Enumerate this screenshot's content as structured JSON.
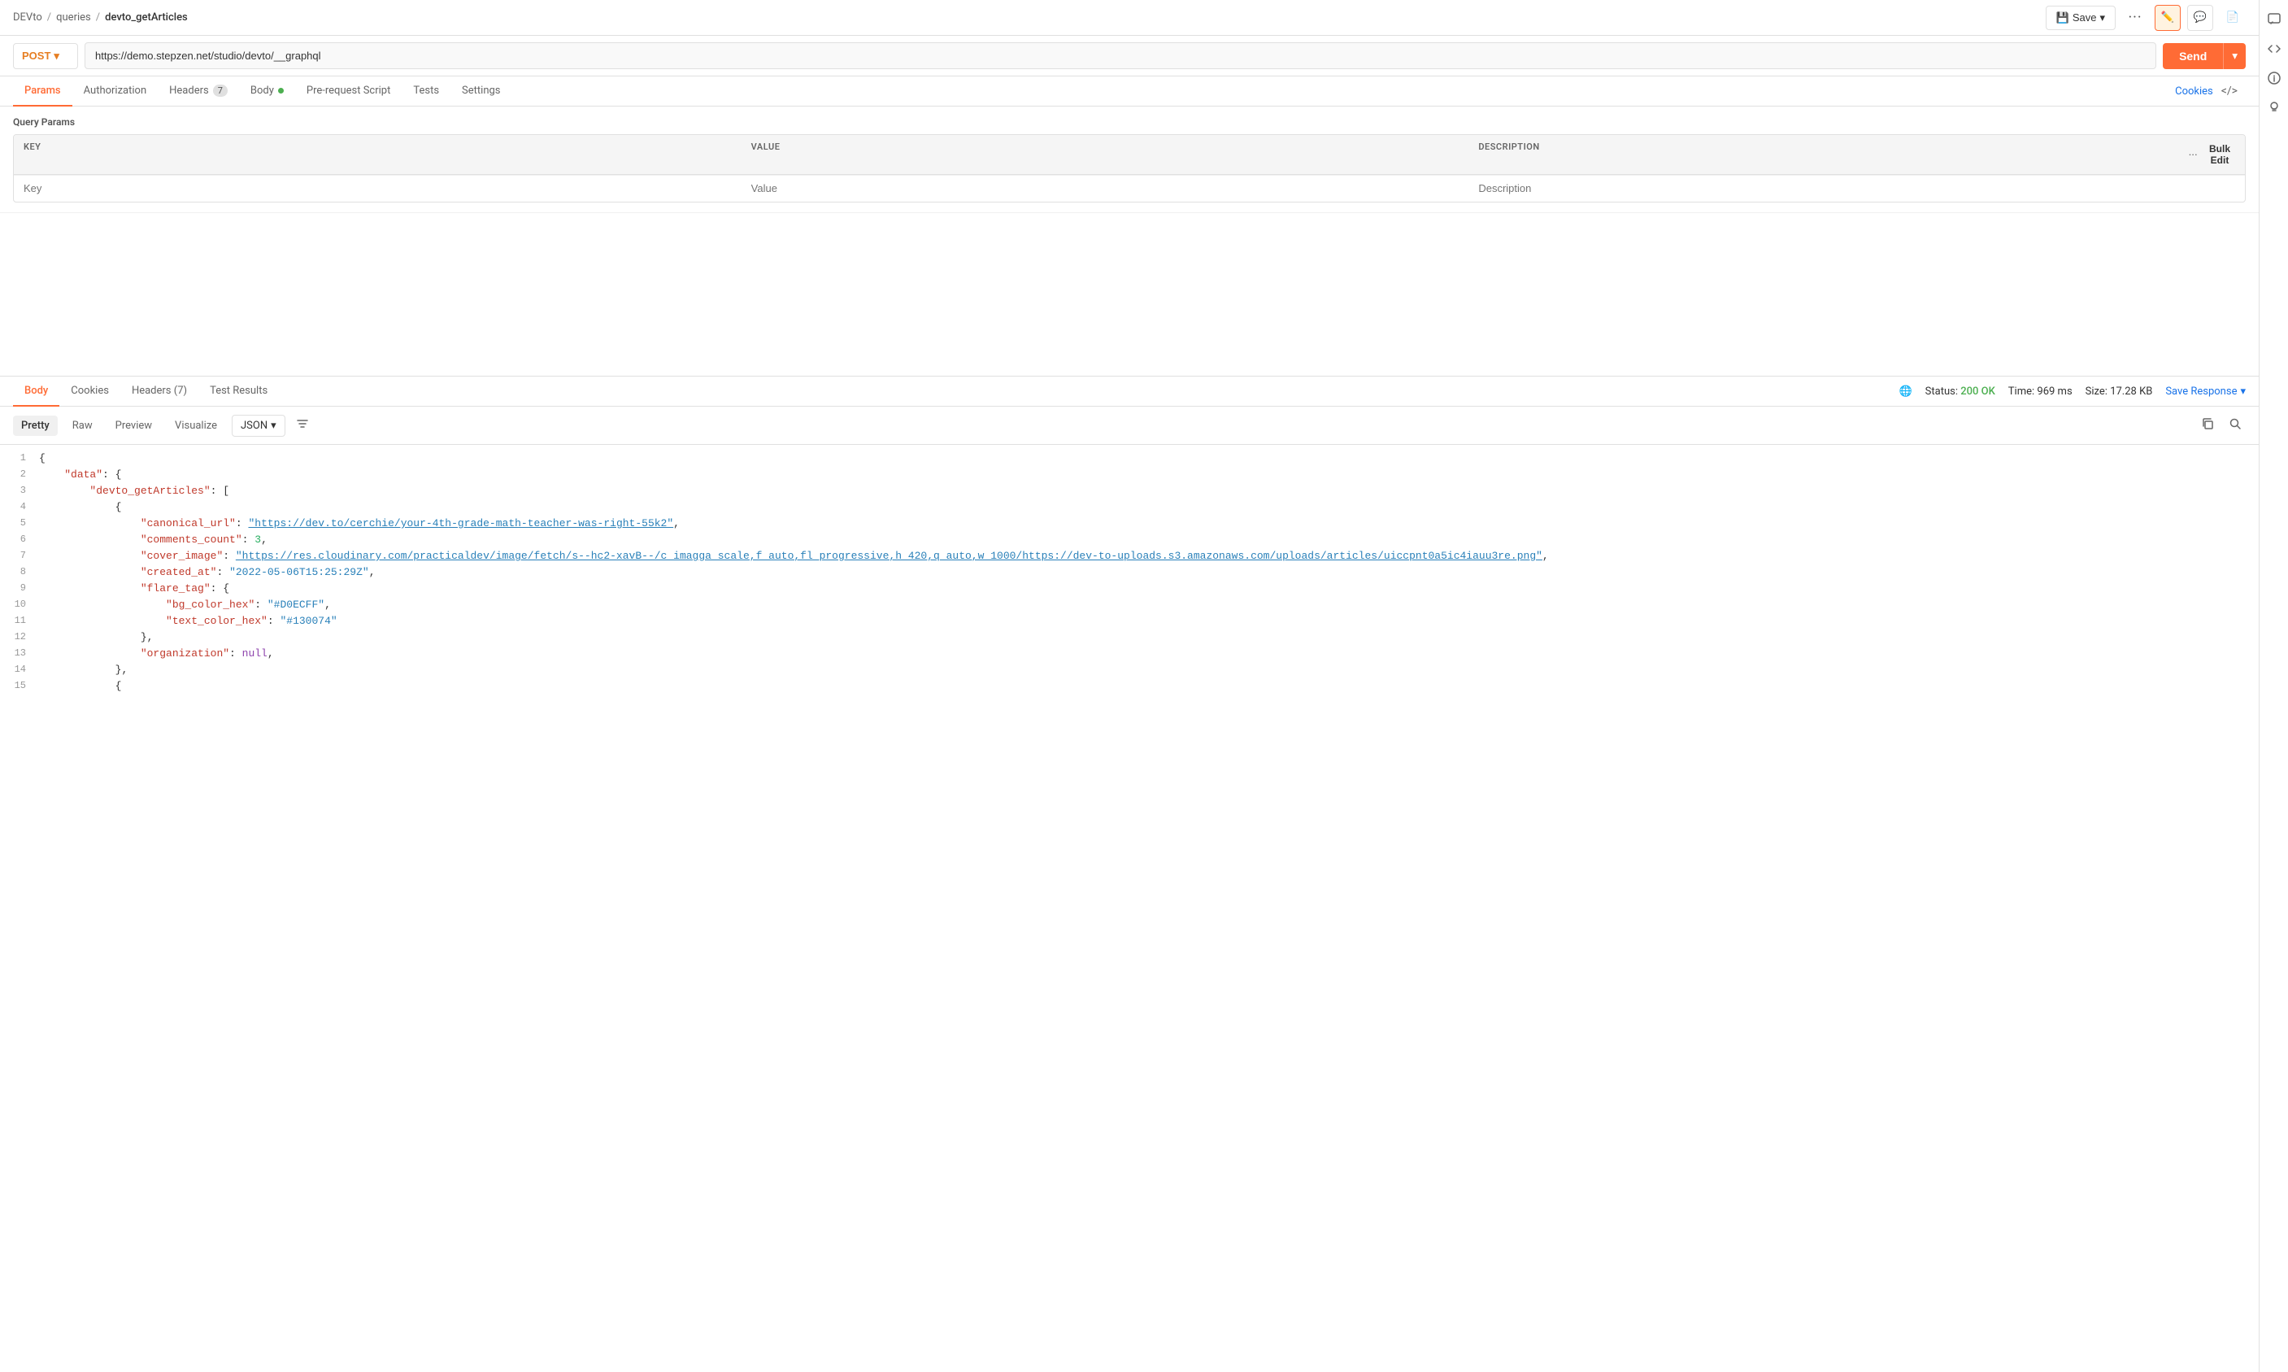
{
  "breadcrumb": {
    "part1": "DEVto",
    "sep1": "/",
    "part2": "queries",
    "sep2": "/",
    "current": "devto_getArticles"
  },
  "toolbar": {
    "save_label": "Save",
    "dots": "···"
  },
  "url_bar": {
    "method": "POST",
    "url": "https://demo.stepzen.net/studio/devto/__graphql",
    "send_label": "Send"
  },
  "tabs": {
    "params": "Params",
    "authorization": "Authorization",
    "headers": "Headers",
    "headers_count": "7",
    "body": "Body",
    "pre_request": "Pre-request Script",
    "tests": "Tests",
    "settings": "Settings",
    "cookies_link": "Cookies"
  },
  "params_section": {
    "title": "Query Params",
    "col_key": "KEY",
    "col_value": "VALUE",
    "col_description": "DESCRIPTION",
    "bulk_edit": "Bulk Edit",
    "key_placeholder": "Key",
    "value_placeholder": "Value",
    "desc_placeholder": "Description"
  },
  "response_tabs": {
    "body": "Body",
    "cookies": "Cookies",
    "headers": "Headers",
    "headers_count": "7",
    "test_results": "Test Results"
  },
  "response_status": {
    "status": "Status:",
    "status_value": "200 OK",
    "time_label": "Time:",
    "time_value": "969 ms",
    "size_label": "Size:",
    "size_value": "17.28 KB",
    "save_response": "Save Response"
  },
  "view_tabs": {
    "pretty": "Pretty",
    "raw": "Raw",
    "preview": "Preview",
    "visualize": "Visualize",
    "format": "JSON"
  },
  "json_content": {
    "lines": [
      {
        "num": 1,
        "content": "{"
      },
      {
        "num": 2,
        "content": "    \"data\": {",
        "type": "key"
      },
      {
        "num": 3,
        "content": "        \"devto_getArticles\": [",
        "type": "key"
      },
      {
        "num": 4,
        "content": "            {"
      },
      {
        "num": 5,
        "content": "                \"canonical_url\": \"https://dev.to/cerchie/your-4th-grade-math-teacher-was-right-55k2\",",
        "type": "key_url"
      },
      {
        "num": 6,
        "content": "                \"comments_count\": 3,",
        "type": "key_num"
      },
      {
        "num": 7,
        "content": "                \"cover_image\": \"https://res.cloudinary.com/practicaldev/image/fetch/s--hc2-xavB--/c_imagga_scale,f_auto,fl_progressive,h_420,q_auto,w_1000/https://dev-to-uploads.s3.amazonaws.com/uploads/articles/uiccpnt0a5ic4iauu3re.png\",",
        "type": "key_url"
      },
      {
        "num": 8,
        "content": "                \"created_at\": \"2022-05-06T15:25:29Z\",",
        "type": "key_str"
      },
      {
        "num": 9,
        "content": "                \"flare_tag\": {",
        "type": "key"
      },
      {
        "num": 10,
        "content": "                    \"bg_color_hex\": \"#D0ECFF\",",
        "type": "key_str"
      },
      {
        "num": 11,
        "content": "                    \"text_color_hex\": \"#130074\"",
        "type": "key_str"
      },
      {
        "num": 12,
        "content": "                },"
      },
      {
        "num": 13,
        "content": "                \"organization\": null,",
        "type": "key_null"
      },
      {
        "num": 14,
        "content": "            },"
      },
      {
        "num": 15,
        "content": "            {"
      }
    ]
  },
  "right_sidebar": {
    "comment_icon": "💬",
    "code_icon": "</>",
    "info_icon": "ⓘ",
    "bulb_icon": "💡"
  }
}
